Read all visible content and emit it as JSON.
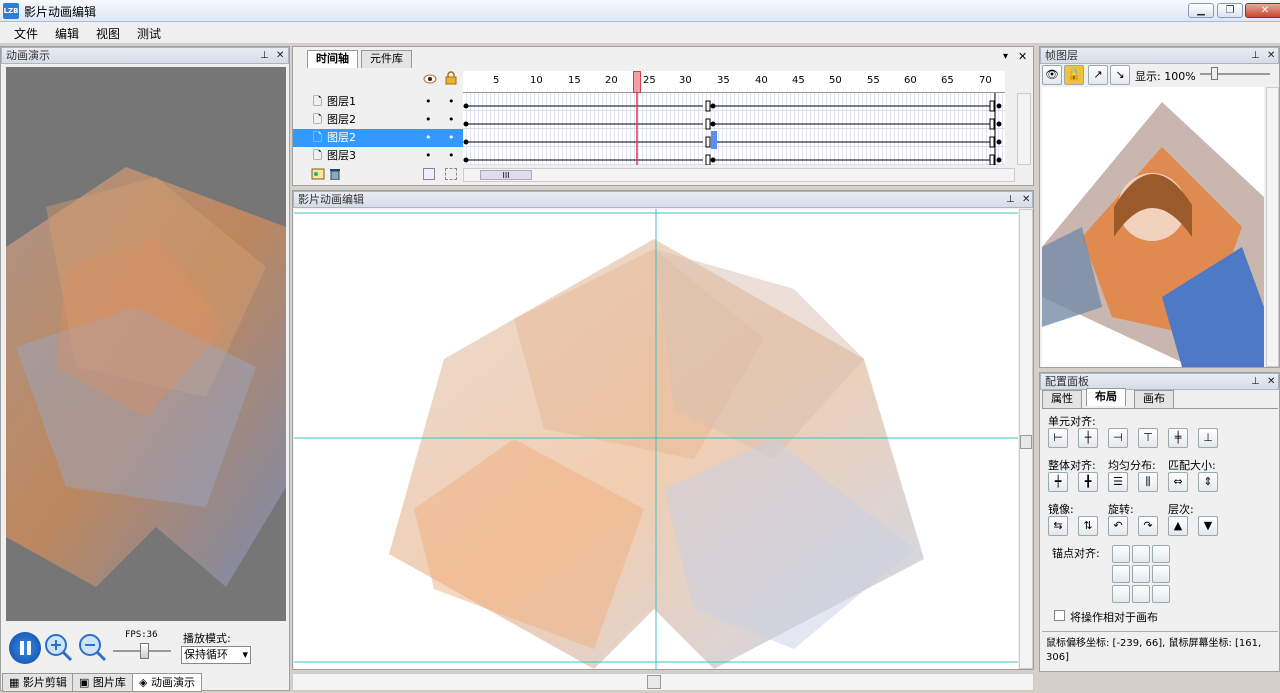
{
  "app": {
    "title": "影片动画编辑",
    "icon_text": "LZB"
  },
  "window_buttons": {
    "minimize": "▁",
    "restore": "❐",
    "close": "✕"
  },
  "menu": [
    "文件",
    "编辑",
    "视图",
    "测试"
  ],
  "left_panel": {
    "title": "动画演示",
    "fps_label": "FPS:36",
    "play_mode_label": "播放模式:",
    "play_mode_value": "保持循环",
    "icons": {
      "pause": "pause-icon",
      "zoom_in": "zoom-in-icon",
      "zoom_out": "zoom-out-icon"
    }
  },
  "timeline": {
    "tabs": [
      "时间轴",
      "元件库"
    ],
    "ruler_numbers": [
      "5",
      "10",
      "15",
      "20",
      "25",
      "30",
      "35",
      "40",
      "45",
      "50",
      "55",
      "60",
      "65",
      "70"
    ],
    "current_frame": 24,
    "layers": [
      {
        "name": "图层1",
        "selected": false
      },
      {
        "name": "图层2",
        "selected": false
      },
      {
        "name": "图层2",
        "selected": true
      },
      {
        "name": "图层3",
        "selected": false
      }
    ],
    "scroll_thumb_label": "III"
  },
  "editor": {
    "title": "影片动画编辑"
  },
  "frame_layer": {
    "title": "帧图层",
    "display_label": "显示: 100%"
  },
  "config": {
    "title": "配置面板",
    "tabs": [
      "属性",
      "布局",
      "画布"
    ],
    "active_tab": "布局",
    "unit_align": "单元对齐:",
    "whole_align": "整体对齐:",
    "distribute": "均匀分布:",
    "match_size": "匹配大小:",
    "mirror": "镜像:",
    "rotate": "旋转:",
    "layer_order": "层次:",
    "anchor_align": "锚点对齐:",
    "checkbox_label": "将操作相对于画布",
    "status_text": "鼠标偏移坐标: [-239, 66], 鼠标屏幕坐标: [161, 306]"
  },
  "bottom_tabs": [
    "影片剪辑",
    "图片库",
    "动画演示"
  ],
  "colors": {
    "selection": "#3399ff",
    "playhead": "#e04050",
    "guide": "#40c0c0"
  }
}
